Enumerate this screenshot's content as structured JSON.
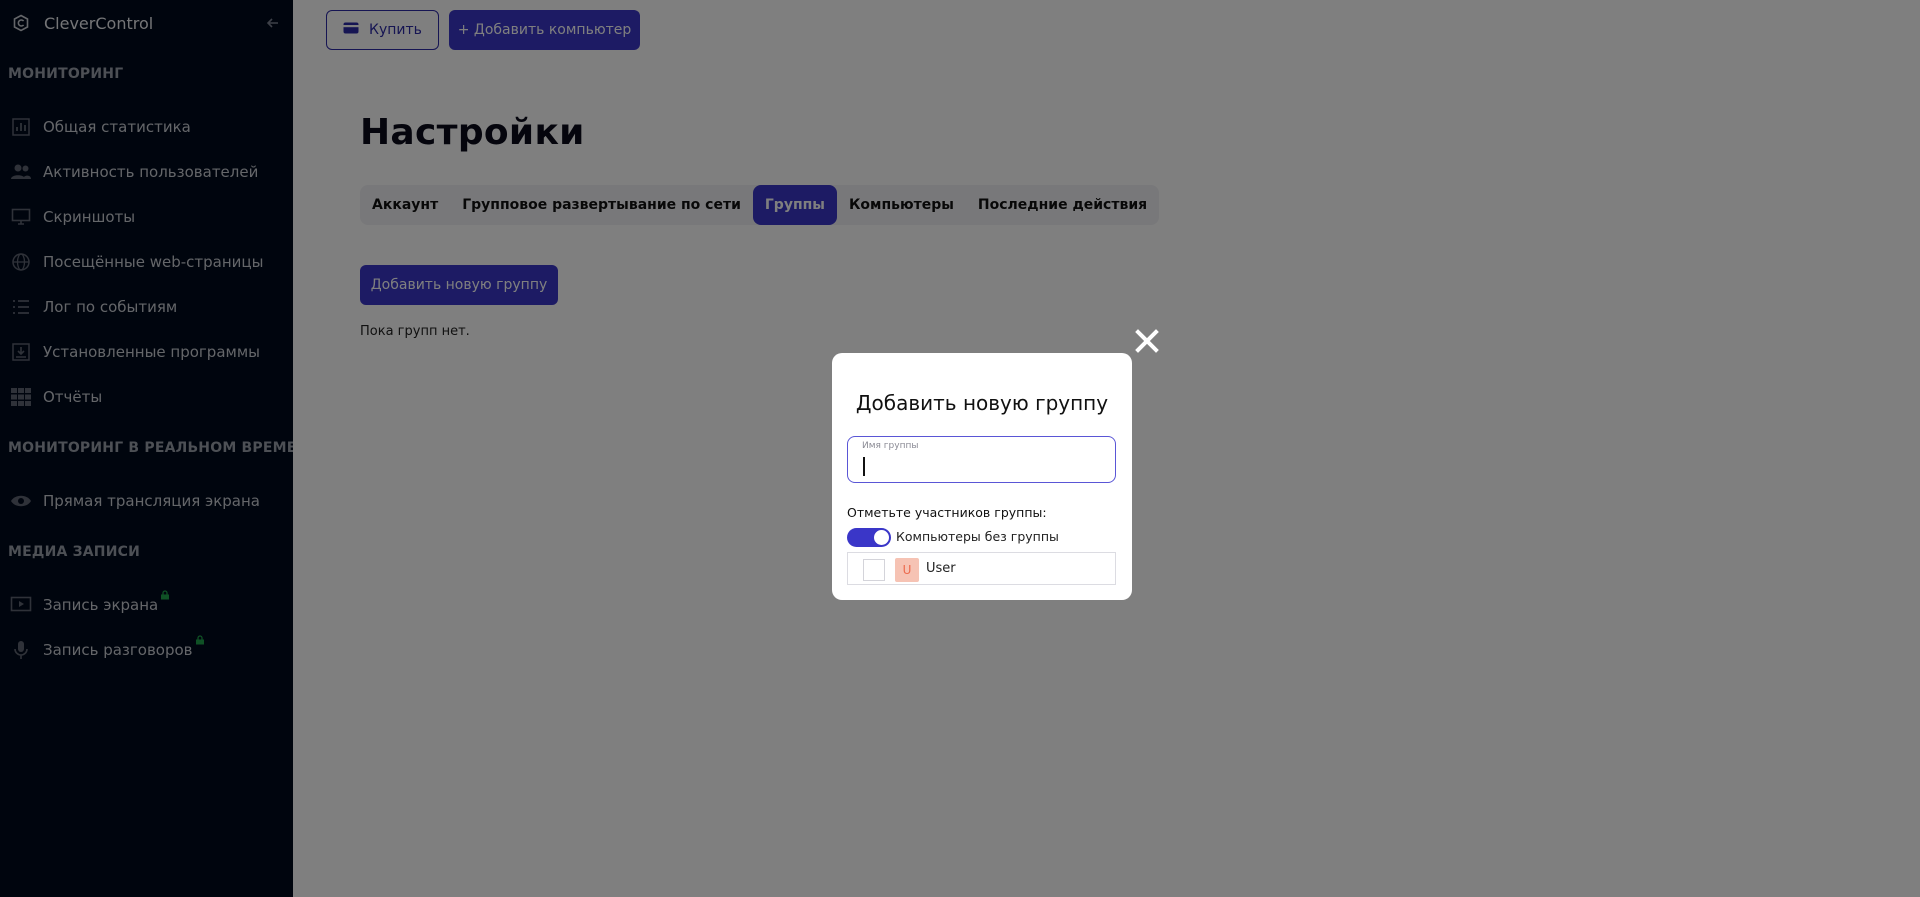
{
  "sidebar": {
    "brand": "CleverControl",
    "sections": {
      "monitoring": "МОНИТОРИНГ",
      "realtime": "МОНИТОРИНГ В РЕАЛЬНОМ ВРЕМЕНИ",
      "media": "МЕДИА ЗАПИСИ"
    },
    "items": [
      {
        "label": "Общая статистика",
        "icon": "bar-chart-icon"
      },
      {
        "label": "Активность пользователей",
        "icon": "users-icon"
      },
      {
        "label": "Скриншоты",
        "icon": "monitor-icon"
      },
      {
        "label": "Посещённые web-страницы",
        "icon": "globe-icon"
      },
      {
        "label": "Лог по событиям",
        "icon": "list-icon"
      },
      {
        "label": "Установленные программы",
        "icon": "install-icon"
      },
      {
        "label": "Отчёты",
        "icon": "grid-icon"
      },
      {
        "label": "Прямая трансляция экрана",
        "icon": "eye-icon"
      },
      {
        "label": "Запись экрана",
        "icon": "play-screen-icon",
        "locked": true
      },
      {
        "label": "Запись разговоров",
        "icon": "microphone-icon",
        "locked": true
      }
    ]
  },
  "topbar": {
    "buy_label": "Купить",
    "add_computer_label": "+ Добавить компьютер"
  },
  "page": {
    "title": "Настройки",
    "tabs": [
      {
        "label": "Аккаунт",
        "active": false
      },
      {
        "label": "Групповое развертывание по сети",
        "active": false
      },
      {
        "label": "Группы",
        "active": true
      },
      {
        "label": "Компьютеры",
        "active": false
      },
      {
        "label": "Последние действия",
        "active": false
      }
    ],
    "add_group_label": "Добавить новую группу",
    "empty_text": "Пока групп нет."
  },
  "modal": {
    "title": "Добавить новую группу",
    "name_label": "Имя группы",
    "name_value": "",
    "members_label": "Отметьте участников группы:",
    "toggle_label": "Компьютеры без группы",
    "toggle_on": true,
    "members": [
      {
        "avatar": "U",
        "name": "User",
        "checked": false
      }
    ]
  },
  "colors": {
    "accent": "#3a36c8",
    "sidebar_bg": "#010a1c",
    "avatar_bg": "#f6c3b4",
    "avatar_fg": "#ec6a4d"
  }
}
